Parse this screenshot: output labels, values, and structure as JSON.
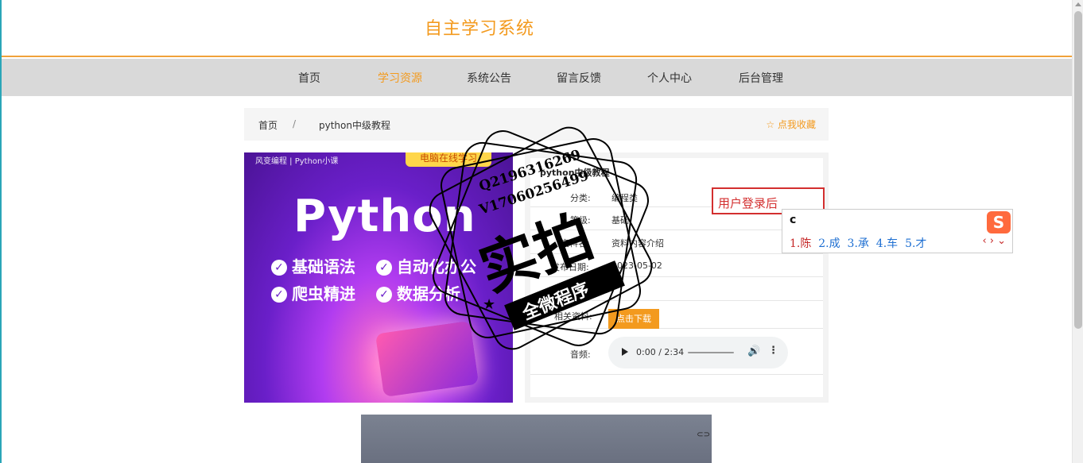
{
  "site": {
    "title": "自主学习系统"
  },
  "nav": [
    {
      "label": "首页",
      "active": false
    },
    {
      "label": "学习资源",
      "active": true
    },
    {
      "label": "系统公告",
      "active": false
    },
    {
      "label": "留言反馈",
      "active": false
    },
    {
      "label": "个人中心",
      "active": false
    },
    {
      "label": "后台管理",
      "active": false
    }
  ],
  "breadcrumb": {
    "home": "首页",
    "separator": "/",
    "current": "python中级教程",
    "favorite": "☆ 点我收藏"
  },
  "cover": {
    "top_left": "风变编程  |  Python小课",
    "tag": "电脑在线学习",
    "headline": "Python",
    "features": [
      "基础语法",
      "自动化办公",
      "爬虫精进",
      "数据分析"
    ]
  },
  "detail": {
    "title": "python中级教程",
    "rows": [
      {
        "label": "分类:",
        "value": "编程类"
      },
      {
        "label": "等级:",
        "value": "基础"
      },
      {
        "label": "资料名:",
        "value": "资料内容介绍"
      },
      {
        "label": "发布日期:",
        "value": "2023-05-02"
      }
    ],
    "resource_label": "相关资料:",
    "download_label": "点击下载",
    "audio_label": "音频:",
    "audio_time": "0:00 / 2:34"
  },
  "input": {
    "value": "用户登录后"
  },
  "ime": {
    "composition": "c",
    "candidates": [
      "1.陈",
      "2.成",
      "3.承",
      "4.车",
      "5.才"
    ],
    "logo": "S"
  },
  "watermark": {
    "contact_q": "Q2196316269",
    "contact_v": "V17060256499",
    "main": "实拍",
    "band": "全微程序"
  },
  "colors": {
    "accent": "#f39a1e",
    "nav_bg": "#d9d9d9",
    "alert": "#d32f2f"
  }
}
